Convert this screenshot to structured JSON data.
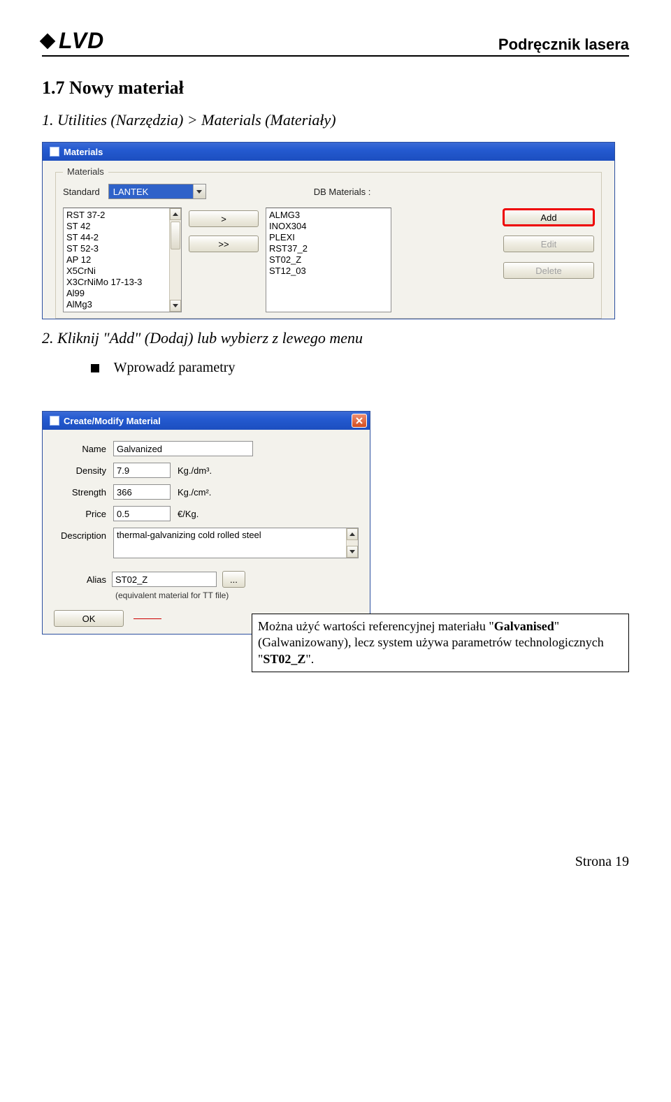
{
  "header": {
    "logo_text": "LVD",
    "doc_title": "Podręcznik lasera"
  },
  "section": {
    "title": "1.7 Nowy materiał",
    "step1": "1. Utilities (Narzędzia) > Materials (Materiały)",
    "step2": "2. Kliknij \"Add\" (Dodaj) lub wybierz z lewego menu",
    "bullet1": "Wprowadź parametry"
  },
  "materials_win": {
    "title": "Materials",
    "group": "Materials",
    "standard_label": "Standard",
    "standard_value": "LANTEK",
    "db_label": "DB Materials :",
    "left_list": [
      "RST 37-2",
      "ST 42",
      "ST 44-2",
      "ST 52-3",
      "AP 12",
      "X5CrNi",
      "X3CrNiMo 17-13-3",
      "Al99",
      "AlMg3"
    ],
    "btn_move": ">",
    "btn_move_all": ">>",
    "right_list": [
      "ALMG3",
      "INOX304",
      "PLEXI",
      "RST37_2",
      "ST02_Z",
      "ST12_03"
    ],
    "btn_add": "Add",
    "btn_edit": "Edit",
    "btn_delete": "Delete"
  },
  "dialog": {
    "title": "Create/Modify Material",
    "name_label": "Name",
    "name_value": "Galvanized",
    "density_label": "Density",
    "density_value": "7.9",
    "density_unit": "Kg./dm³.",
    "strength_label": "Strength",
    "strength_value": "366",
    "strength_unit": "Kg./cm².",
    "price_label": "Price",
    "price_value": "0.5",
    "price_unit": "€/Kg.",
    "desc_label": "Description",
    "desc_value": "thermal-galvanizing cold rolled steel",
    "alias_label": "Alias",
    "alias_value": "ST02_Z",
    "alias_btn": "...",
    "equiv_note": "(equivalent material for TT file)",
    "ok": "OK"
  },
  "callout": {
    "text1": "Można użyć wartości referencyjnej materiału \"",
    "bold1": "Galvanised",
    "text2": "\" (Galwanizowany), lecz system używa parametrów technologicznych \"",
    "bold2": "ST02_Z",
    "text3": "\"."
  },
  "footer": {
    "page": "Strona 19"
  }
}
